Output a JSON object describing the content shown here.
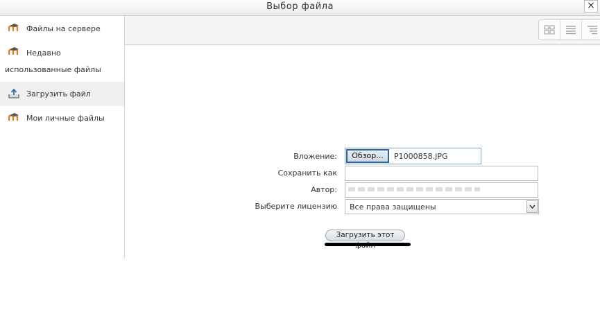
{
  "dialog": {
    "title": "Выбор файла",
    "close_glyph": "×"
  },
  "sidebar": {
    "items": [
      {
        "label": "Файлы на сервере",
        "icon": "moodle-icon"
      },
      {
        "label_line1": "Недавно",
        "label_line2": "использованные файлы",
        "icon": "moodle-icon"
      },
      {
        "label": "Загрузить файл",
        "icon": "upload-icon",
        "active": true
      },
      {
        "label": "Мои личные файлы",
        "icon": "moodle-icon"
      }
    ]
  },
  "toolbar": {
    "views": [
      "icons-view-icon",
      "list-view-icon",
      "tree-view-icon"
    ]
  },
  "form": {
    "attachment_label": "Вложение:",
    "browse_label": "Обзор...",
    "file_name": "P1000858.JPG",
    "save_as_label": "Сохранить как",
    "save_as_value": "",
    "author_label": "Автор:",
    "license_label": "Выберите лицензию",
    "license_value": "Все права защищены",
    "upload_button": "Загрузить этот файл"
  },
  "colors": {
    "accent_border": "#2b62a8",
    "active_item_bg": "#f0f0f0"
  }
}
